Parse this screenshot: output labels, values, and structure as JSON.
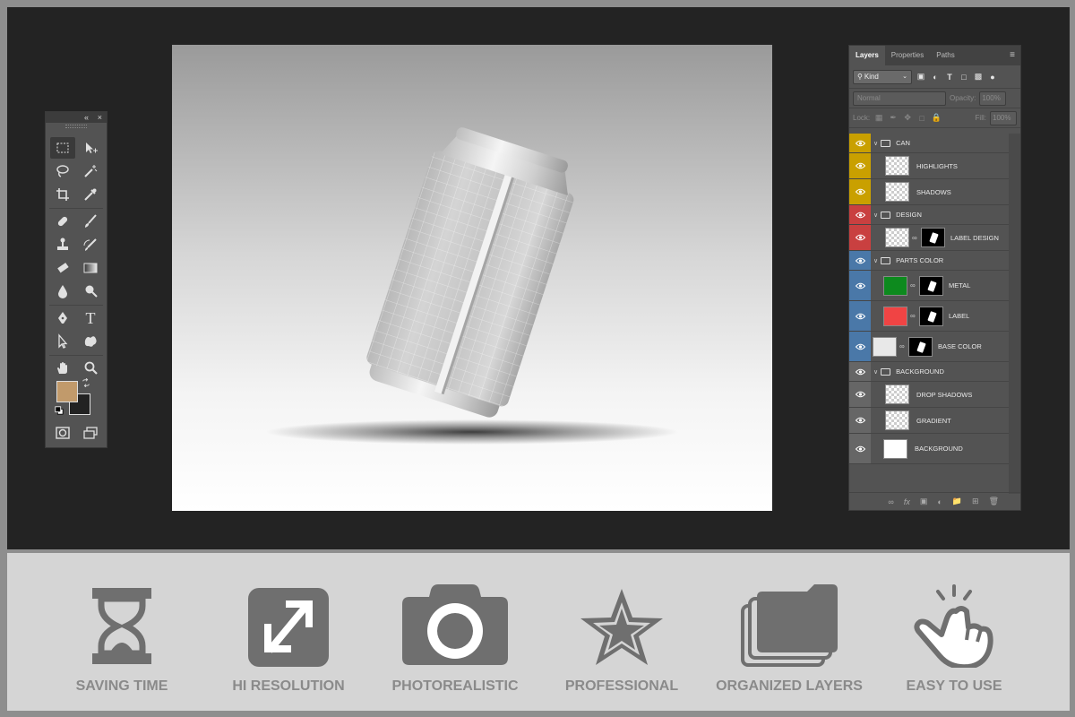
{
  "toolbox": {
    "collapse_glyph": "«",
    "close_glyph": "×",
    "tools": [
      {
        "name": "rectangular-marquee-icon"
      },
      {
        "name": "move-icon"
      },
      {
        "name": "lasso-icon"
      },
      {
        "name": "magic-wand-icon"
      },
      {
        "name": "crop-icon"
      },
      {
        "name": "eyedropper-icon"
      },
      {
        "name": "healing-brush-icon"
      },
      {
        "name": "brush-icon"
      },
      {
        "name": "clone-stamp-icon"
      },
      {
        "name": "history-brush-icon"
      },
      {
        "name": "eraser-icon"
      },
      {
        "name": "gradient-icon"
      },
      {
        "name": "blur-icon"
      },
      {
        "name": "dodge-icon"
      },
      {
        "name": "pen-icon"
      },
      {
        "name": "type-icon"
      },
      {
        "name": "path-selection-icon"
      },
      {
        "name": "custom-shape-icon"
      },
      {
        "name": "hand-icon"
      },
      {
        "name": "zoom-icon"
      },
      {
        "name": "quick-mask-icon"
      },
      {
        "name": "screen-mode-icon"
      }
    ],
    "type_glyph": "T",
    "foreground_color": "#c19a6b",
    "background_color": "#222222"
  },
  "layers_panel": {
    "tabs": [
      "Layers",
      "Properties",
      "Paths"
    ],
    "menu_glyph": "≡",
    "filter_kind": "Kind",
    "blend_mode": "Normal",
    "opacity_label": "Opacity:",
    "opacity_value": "100%",
    "lock_label": "Lock:",
    "fill_label": "Fill:",
    "fill_value": "100%",
    "layers": [
      {
        "name": "CAN",
        "type": "group",
        "color": "#c9a000"
      },
      {
        "name": "HIGHLIGHTS",
        "type": "layer",
        "color": "#c9a000"
      },
      {
        "name": "SHADOWS",
        "type": "layer",
        "color": "#c9a000"
      },
      {
        "name": "DESIGN",
        "type": "group",
        "color": "#c94040"
      },
      {
        "name": "LABEL DESIGN",
        "type": "smart",
        "color": "#c94040"
      },
      {
        "name": "PARTS COLOR",
        "type": "group",
        "color": "#4a78a8"
      },
      {
        "name": "METAL",
        "type": "fill",
        "color": "#4a78a8",
        "thumb": "#0d8a1e"
      },
      {
        "name": "LABEL",
        "type": "fill",
        "color": "#4a78a8",
        "thumb": "#f04444"
      },
      {
        "name": "BASE COLOR",
        "type": "fill",
        "color": "#4a78a8",
        "thumb": "#e8e8e8"
      },
      {
        "name": "BACKGROUND",
        "type": "group",
        "color": "#666666"
      },
      {
        "name": "DROP SHADOWS",
        "type": "layer",
        "color": "#666666"
      },
      {
        "name": "GRADIENT",
        "type": "layer",
        "color": "#666666"
      },
      {
        "name": "BACKGROUND",
        "type": "solid",
        "color": "#666666"
      }
    ]
  },
  "features": [
    {
      "label": "SAVING TIME",
      "icon": "hourglass-icon"
    },
    {
      "label": "HI RESOLUTION",
      "icon": "expand-arrows-icon"
    },
    {
      "label": "PHOTOREALISTIC",
      "icon": "camera-icon"
    },
    {
      "label": "PROFESSIONAL",
      "icon": "star-icon"
    },
    {
      "label": "ORGANIZED LAYERS",
      "icon": "stacked-layers-icon"
    },
    {
      "label": "EASY TO USE",
      "icon": "tap-hand-icon"
    }
  ]
}
